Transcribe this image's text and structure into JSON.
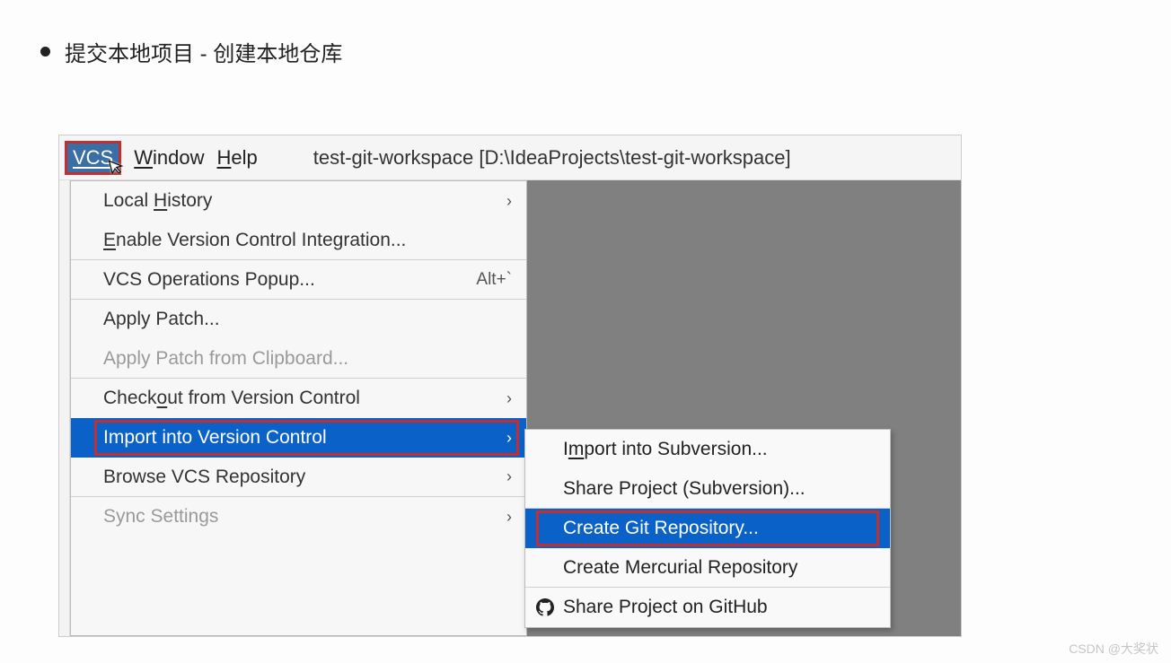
{
  "heading": "提交本地项目 - 创建本地仓库",
  "menubar": {
    "vcs": "VCS",
    "window": "Window",
    "help": "Help",
    "title": "test-git-workspace [D:\\IdeaProjects\\test-git-workspace]"
  },
  "menu1": {
    "local_history": "Local History",
    "enable_vcs": "Enable Version Control Integration...",
    "vcs_popup": "VCS Operations Popup...",
    "vcs_popup_shortcut": "Alt+`",
    "apply_patch": "Apply Patch...",
    "apply_patch_clip": "Apply Patch from Clipboard...",
    "checkout": "Checkout from Version Control",
    "import_vc": "Import into Version Control",
    "browse_repo": "Browse VCS Repository",
    "sync": "Sync Settings"
  },
  "menu2": {
    "import_svn": "Import into Subversion...",
    "share_svn": "Share Project (Subversion)...",
    "create_git": "Create Git Repository...",
    "create_hg": "Create Mercurial Repository",
    "share_github": "Share Project on GitHub"
  },
  "chevron": "›",
  "watermark": "CSDN @大奖状"
}
